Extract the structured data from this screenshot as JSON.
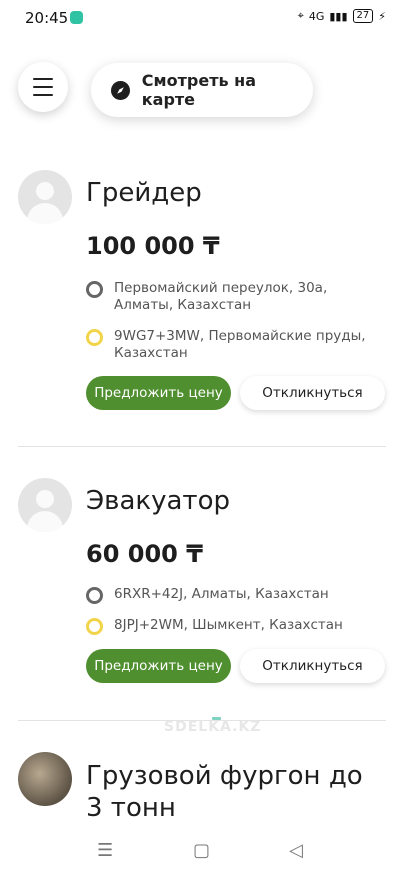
{
  "status": {
    "time": "20:45",
    "network": "4G",
    "battery": "27"
  },
  "top": {
    "map_label": "Смотреть на карте"
  },
  "listings": [
    {
      "title": "Грейдер",
      "price": "100 000 ₸",
      "from": "Первомайский переулок, 30а, Алматы, Казахстан",
      "to": "9WG7+3MW, Первомайские пруды, Казахстан",
      "offer_label": "Предложить цену",
      "reply_label": "Откликнуться"
    },
    {
      "title": "Эвакуатор",
      "price": "60 000 ₸",
      "from": "6RXR+42J, Алматы, Казахстан",
      "to": "8JPJ+2WM, Шымкент, Казахстан",
      "offer_label": "Предложить цену",
      "reply_label": "Откликнуться"
    },
    {
      "title": "Грузовой фургон до 3 тонн"
    }
  ],
  "watermark": "SDELKA.KZ",
  "nav": {
    "recent": "☰",
    "home": "▢",
    "back": "◁"
  },
  "colors": {
    "accent_green": "#4f8f2f",
    "dot_gray": "#666666",
    "dot_yellow": "#f2d44b"
  }
}
